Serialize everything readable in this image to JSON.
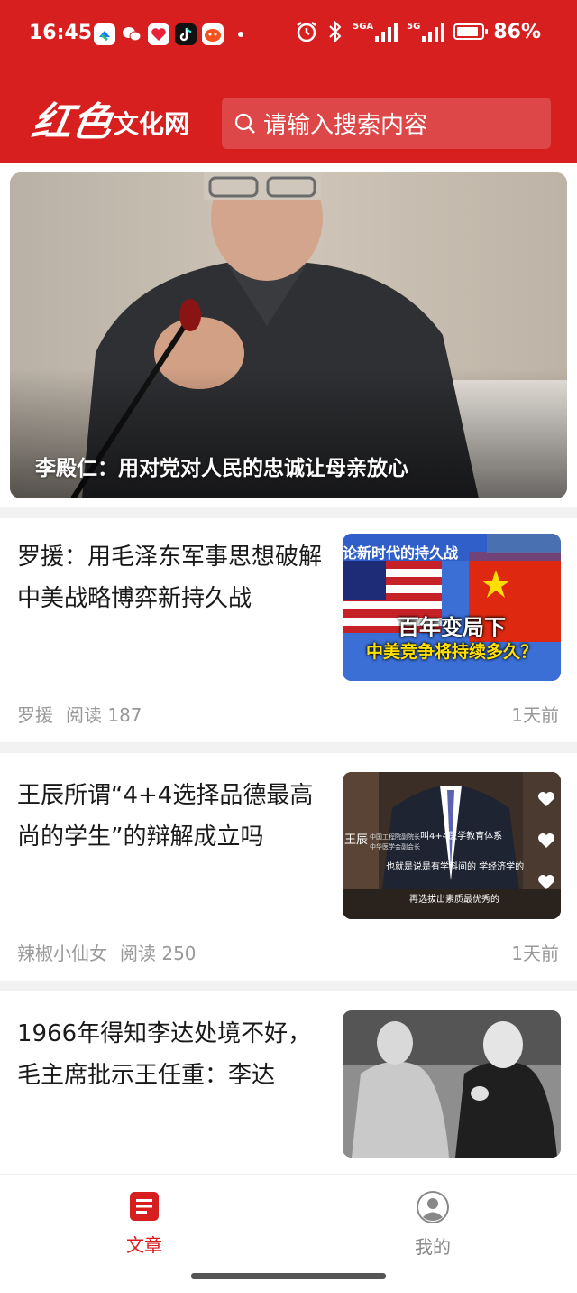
{
  "status_bar": {
    "time": "16:45",
    "network_label": "5GA",
    "network_label_2": "5G",
    "battery": "86%",
    "battery_level": 0.86,
    "app_icons": [
      "alipay-icon",
      "wechat-icon",
      "heart-app-icon",
      "tiktok-icon",
      "game-app-icon"
    ]
  },
  "header": {
    "logo_hand": "红色",
    "logo_text": "文化网",
    "search_placeholder": "请输入搜索内容"
  },
  "hero": {
    "caption": "李殿仁：用对党对人民的忠诚让母亲放心"
  },
  "articles": [
    {
      "title": "罗援：用毛泽东军事思想破解中美战略博弈新持久战",
      "author": "罗援",
      "reads": "阅读 187",
      "time": "1天前",
      "thumb_texts": [
        "论新时代的持久战",
        "百年变局下",
        "中美竞争将持续多久？"
      ]
    },
    {
      "title": "王辰所谓“4+4选择品德最高尚的学生”的辩解成立吗",
      "author": "辣椒小仙女",
      "reads": "阅读 250",
      "time": "1天前",
      "thumb_texts": [
        "叫4+4医学教育体系",
        "王辰",
        "中国工程院副院长",
        "中华医学会副会长",
        "也就是说是有学科间的 学经济学的",
        "再选拔出素质最优秀的"
      ]
    },
    {
      "title": "1966年得知李达处境不好，毛主席批示王任重：李达",
      "author": "",
      "reads": "",
      "time": "",
      "thumb_texts": []
    }
  ],
  "tabbar": {
    "tabs": [
      {
        "label": "文章",
        "icon": "article-icon",
        "active": true
      },
      {
        "label": "我的",
        "icon": "profile-icon",
        "active": false
      }
    ]
  },
  "colors": {
    "brand_red": "#d71f20",
    "muted_text": "#999999",
    "inactive_tab": "#888888"
  }
}
